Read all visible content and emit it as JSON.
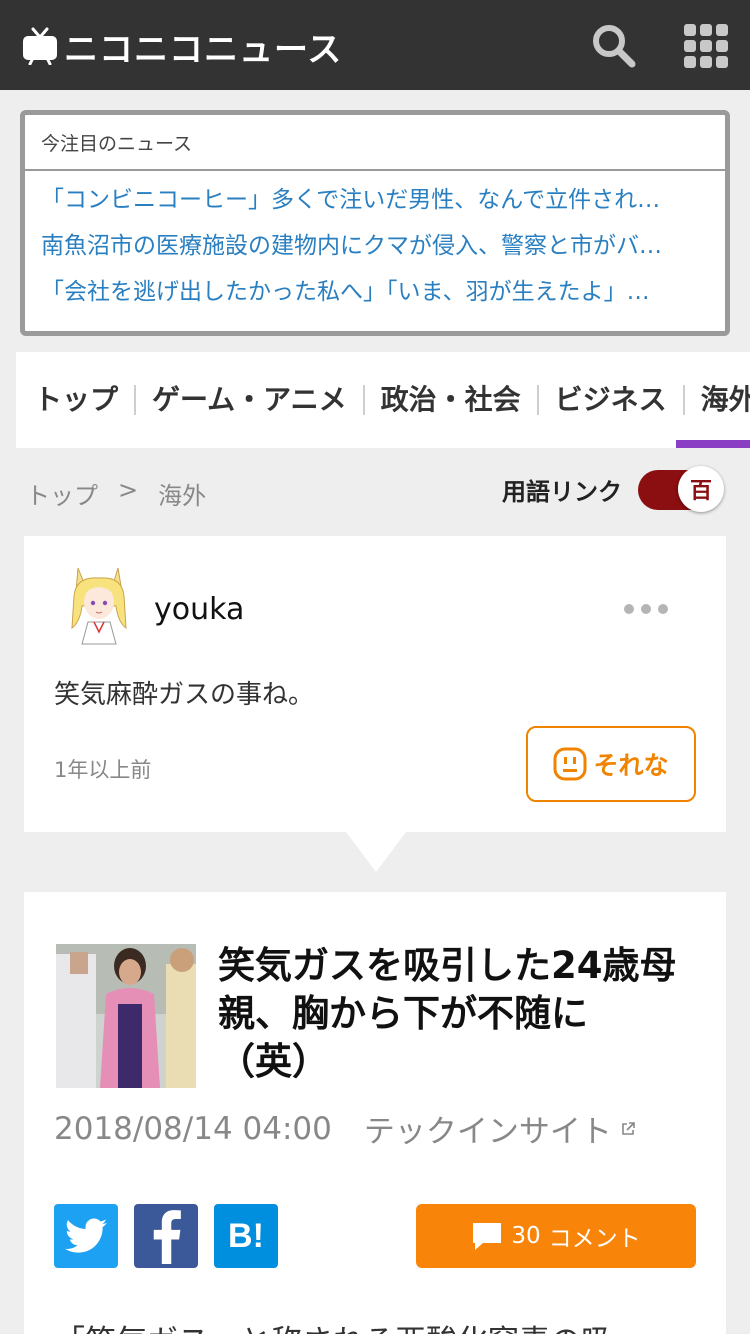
{
  "header": {
    "logo_text": "ニコニコニュース",
    "search_icon": "search-icon",
    "menu_icon": "grid-menu-icon"
  },
  "trending": {
    "heading": "今注目のニュース",
    "items": [
      "「コンビニコーヒー」多くで注いだ男性、なんで立件され…",
      "南魚沼市の医療施設の建物内にクマが侵入、警察と市がバ…",
      "「会社を逃げ出したかった私へ」「いま、羽が生えたよ」…"
    ]
  },
  "tabs": {
    "items": [
      "トップ",
      "ゲーム・アニメ",
      "政治・社会",
      "ビジネス",
      "海外"
    ],
    "active": "海外",
    "active_color": "#8a3ec3"
  },
  "breadcrumb": {
    "home": "トップ",
    "separator": ">",
    "current": "海外"
  },
  "term_link": {
    "label": "用語リンク",
    "toggle_glyph": "百",
    "enabled": true,
    "color": "#8b0e10"
  },
  "comment": {
    "user": "youka",
    "text": "笑気麻酔ガスの事ね。",
    "time": "1年以上前",
    "reaction_label": "それな",
    "reaction_color": "#f08300"
  },
  "article": {
    "title": "笑気ガスを吸引した24歳母親、胸から下が不随に（英）",
    "date": "2018/08/14 04:00",
    "source": "テックインサイト",
    "comment_count": "30",
    "comment_label": "コメント",
    "hatena_label": "B!",
    "body_start": "「笑気ガス」と称される亜酸化窒素の吸"
  }
}
